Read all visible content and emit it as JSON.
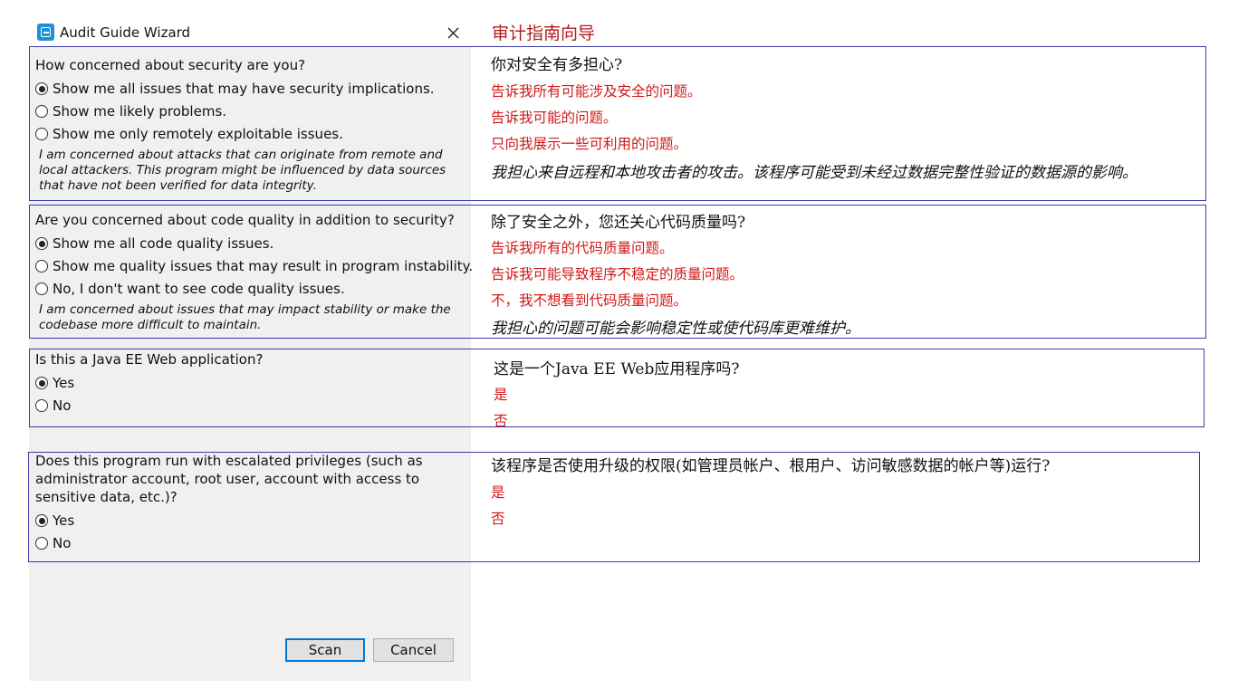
{
  "window": {
    "title": "Audit Guide Wizard",
    "cn_title": "审计指南向导",
    "icon": "app-icon",
    "close_icon": "close-icon"
  },
  "sections": [
    {
      "question": "How concerned about security are you?",
      "options": [
        {
          "label": "Show me all issues that may have security implications.",
          "checked": true
        },
        {
          "label": "Show me likely problems.",
          "checked": false
        },
        {
          "label": "Show me only remotely exploitable issues.",
          "checked": false
        }
      ],
      "description_lines": [
        "I am concerned about attacks that can originate from remote and",
        "local attackers. This program might be influenced by data sources",
        "that have not been verified for data integrity."
      ],
      "cn_question": "你对安全有多担心?",
      "cn_options": [
        "告诉我所有可能涉及安全的问题。",
        "告诉我可能的问题。",
        "只向我展示一些可利用的问题。"
      ],
      "cn_description": "我担心来自远程和本地攻击者的攻击。该程序可能受到未经过数据完整性验证的数据源的影响。"
    },
    {
      "question": "Are you concerned about code quality in addition to security?",
      "options": [
        {
          "label": "Show me all code quality issues.",
          "checked": true
        },
        {
          "label": "Show me quality issues that may result in program instability.",
          "checked": false
        },
        {
          "label": "No, I don't want to see code quality issues.",
          "checked": false
        }
      ],
      "description_lines": [
        "I am concerned about issues that may impact stability or make the",
        "codebase more difficult to maintain."
      ],
      "cn_question": "除了安全之外，您还关心代码质量吗?",
      "cn_options": [
        "告诉我所有的代码质量问题。",
        "告诉我可能导致程序不稳定的质量问题。",
        "不，我不想看到代码质量问题。"
      ],
      "cn_description": "我担心的问题可能会影响稳定性或使代码库更难维护。"
    },
    {
      "question": "Is this a Java EE Web application?",
      "options": [
        {
          "label": "Yes",
          "checked": true
        },
        {
          "label": "No",
          "checked": false
        }
      ],
      "cn_question": "这是一个Java EE Web应用程序吗?",
      "cn_options": [
        "是",
        "否"
      ]
    },
    {
      "question_lines": [
        "Does this program run with escalated privileges (such as",
        "administrator account, root user, account with access to",
        "sensitive data, etc.)?"
      ],
      "options": [
        {
          "label": "Yes",
          "checked": true
        },
        {
          "label": "No",
          "checked": false
        }
      ],
      "cn_question": "该程序是否使用升级的权限(如管理员帐户、根用户、访问敏感数据的帐户等)运行?",
      "cn_options": [
        "是",
        "否"
      ]
    }
  ],
  "buttons": {
    "scan": "Scan",
    "cancel": "Cancel"
  },
  "colors": {
    "accent": "#0078d7",
    "section_border": "#3c3ca8",
    "translation_red": "#d01818"
  }
}
